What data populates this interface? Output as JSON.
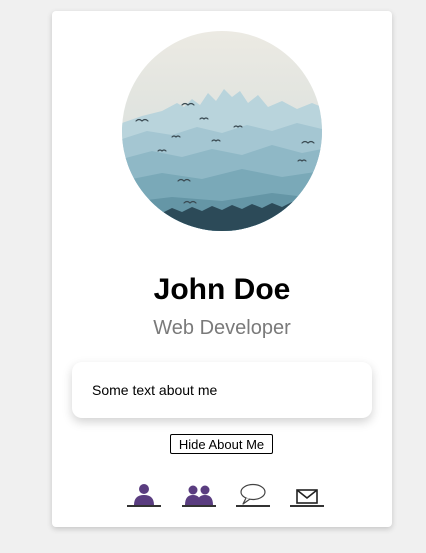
{
  "profile": {
    "name": "John Doe",
    "title": "Web Developer",
    "avatar_alt": "Misty blue mountains with birds"
  },
  "about": {
    "text": "Some text about me",
    "toggle_label": "Hide About Me"
  },
  "social_icons": [
    {
      "icon": "user-icon",
      "color": "#5a3d80"
    },
    {
      "icon": "users-icon",
      "color": "#5a3d80"
    },
    {
      "icon": "chat-bubble-icon",
      "color": "#444444"
    },
    {
      "icon": "envelope-icon",
      "color": "#222222"
    }
  ],
  "colors": {
    "accent": "#5a3d80",
    "subtitle": "#7a7a7a"
  }
}
